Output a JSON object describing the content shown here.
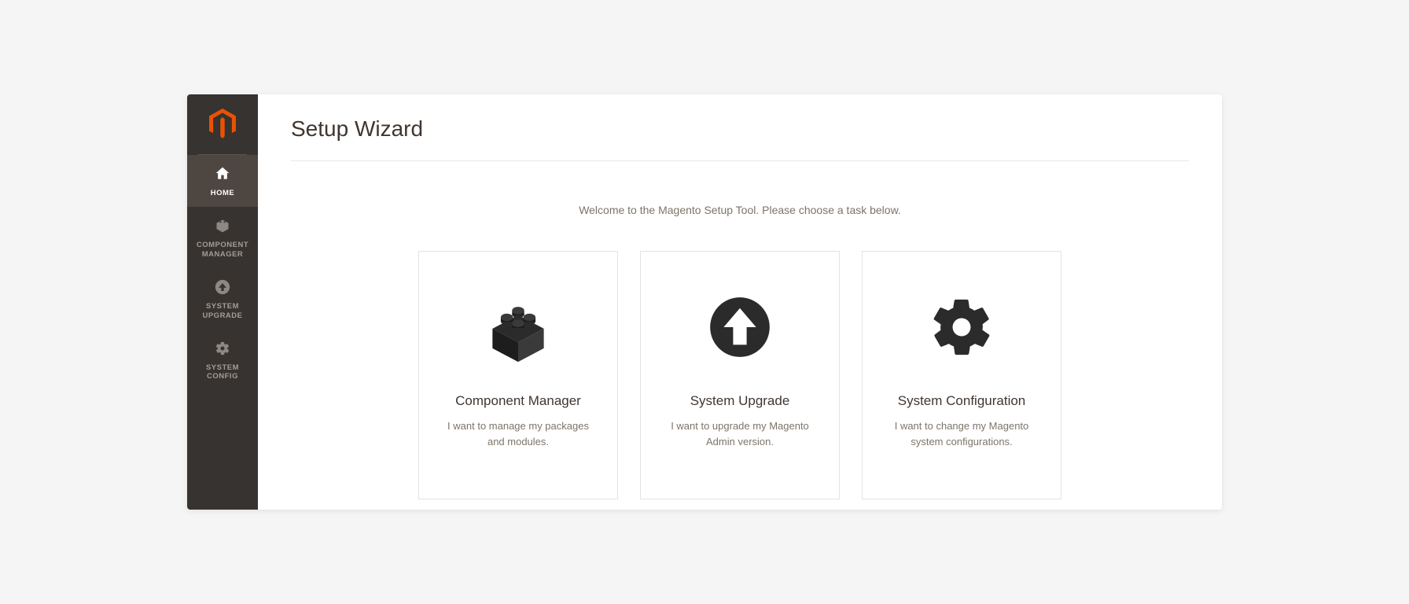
{
  "page": {
    "title": "Setup Wizard",
    "welcome": "Welcome to the Magento Setup Tool. Please choose a task below."
  },
  "sidebar": {
    "items": [
      {
        "label": "HOME",
        "icon": "home-icon",
        "active": true
      },
      {
        "label": "COMPONENT MANAGER",
        "icon": "block-icon",
        "active": false
      },
      {
        "label": "SYSTEM UPGRADE",
        "icon": "upgrade-icon",
        "active": false
      },
      {
        "label": "SYSTEM CONFIG",
        "icon": "gear-icon",
        "active": false
      }
    ]
  },
  "cards": [
    {
      "title": "Component Manager",
      "desc": "I want to manage my packages and modules.",
      "icon": "block-icon"
    },
    {
      "title": "System Upgrade",
      "desc": "I want to upgrade my Magento Admin version.",
      "icon": "upgrade-icon"
    },
    {
      "title": "System Configuration",
      "desc": "I want to change my Magento system configurations.",
      "icon": "gear-icon"
    }
  ],
  "colors": {
    "sidebar_bg": "#373330",
    "accent": "#eb5202"
  }
}
